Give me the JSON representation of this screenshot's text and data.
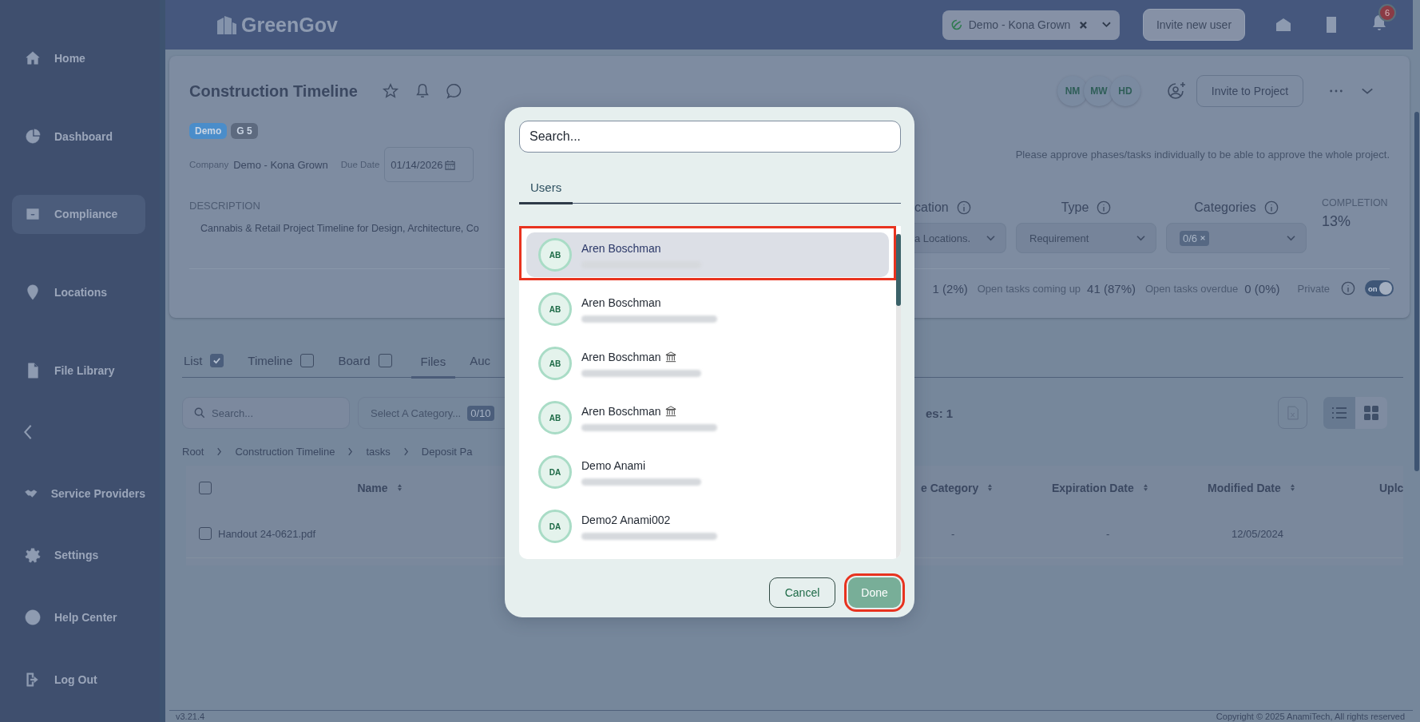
{
  "sidebar": {
    "items": [
      {
        "label": "Home",
        "selected": false
      },
      {
        "label": "Dashboard",
        "selected": false
      },
      {
        "label": "Compliance",
        "selected": true
      },
      {
        "label": "Locations",
        "selected": false
      },
      {
        "label": "File Library",
        "selected": false
      }
    ],
    "lower_items": [
      {
        "label": "Service Providers",
        "selected": false
      },
      {
        "label": "Settings",
        "selected": false
      },
      {
        "label": "Help Center",
        "selected": false
      },
      {
        "label": "Log Out",
        "selected": false
      }
    ]
  },
  "topbar": {
    "logo": "GreenGov",
    "company_select": "Demo - Kona Grown",
    "invite_button": "Invite new user",
    "notification_count": "6"
  },
  "project": {
    "title": "Construction Timeline",
    "tags": [
      {
        "label": "Demo",
        "color": "#4a8dca"
      },
      {
        "label": "G 5",
        "color": "#5d6a7f"
      }
    ],
    "company_label": "Company",
    "company": "Demo - Kona Grown",
    "due_date_label": "Due Date",
    "due_date": "01/14/2026",
    "description_label": "DESCRIPTION",
    "description": "Cannabis & Retail Project Timeline for Design, Architecture, Co",
    "members": [
      "NM",
      "MW",
      "HD"
    ],
    "invite_button": "Invite to Project",
    "note": "Please approve phases/tasks individually to be able to approve the whole project.",
    "filters": [
      {
        "label": "cation",
        "kind": "select",
        "value": "a Locations."
      },
      {
        "label": "Type",
        "kind": "select",
        "value": "Requirement"
      },
      {
        "label": "Categories",
        "kind": "chip",
        "value": "0/6"
      }
    ],
    "completion_label": "COMPLETION",
    "completion": "13%",
    "stats": [
      {
        "value": "1 (2%)"
      },
      {
        "label": "Open tasks coming up",
        "value": "41 (87%)"
      },
      {
        "label": "Open tasks overdue",
        "value": "0 (0%)"
      }
    ],
    "private": {
      "label": "Private",
      "on": true,
      "toggle_text": "on"
    }
  },
  "view_tabs": [
    {
      "label": "List",
      "kind": "checkbox",
      "checked": true,
      "selected": false
    },
    {
      "label": "Timeline",
      "kind": "checkbox",
      "checked": false,
      "selected": false
    },
    {
      "label": "Board",
      "kind": "checkbox",
      "checked": false,
      "selected": false
    },
    {
      "label": "Files",
      "kind": "plain",
      "selected": true
    },
    {
      "label": "Auc",
      "kind": "plain",
      "selected": false
    }
  ],
  "files": {
    "search_placeholder": "Search...",
    "category_placeholder": "Select A Category...",
    "category_count": "0/10",
    "file_count": "es: 1",
    "view_toggle": [
      {
        "selected": true
      },
      {
        "selected": false
      }
    ],
    "breadcrumb": [
      "Root",
      "Construction Timeline",
      "tasks",
      "Deposit Pa"
    ],
    "select_all_checked": false,
    "columns": [
      {
        "label": "Name",
        "sortable": true
      },
      {
        "label": "e Category",
        "sortable": true
      },
      {
        "label": "Expiration Date",
        "sortable": true
      },
      {
        "label": "Modified Date",
        "sortable": true
      },
      {
        "label": "Uplc",
        "sortable": false
      }
    ],
    "rows": [
      {
        "checked": false,
        "cells": [
          "Handout 24-0621.pdf",
          "-",
          "-",
          "12/05/2024"
        ]
      }
    ]
  },
  "footer": {
    "version": "v3.21.4",
    "copyright": "Copyright © 2025 AnamiTech, All rights reserved"
  },
  "modal": {
    "search_placeholder": "Search...",
    "tabs": [
      {
        "label": "Users",
        "selected": true
      }
    ],
    "users": [
      {
        "initials": "AB",
        "name": "Aren Boschman",
        "institution": false,
        "selected": true,
        "highlighted": true
      },
      {
        "initials": "AB",
        "name": "Aren Boschman",
        "institution": false,
        "selected": false,
        "highlighted": false
      },
      {
        "initials": "AB",
        "name": "Aren Boschman",
        "institution": true,
        "selected": false,
        "highlighted": false
      },
      {
        "initials": "AB",
        "name": "Aren Boschman",
        "institution": true,
        "selected": false,
        "highlighted": false
      },
      {
        "initials": "DA",
        "name": "Demo Anami",
        "institution": false,
        "selected": false,
        "highlighted": false
      },
      {
        "initials": "DA",
        "name": "Demo2 Anami002",
        "institution": false,
        "selected": false,
        "highlighted": false
      }
    ],
    "cancel_button": "Cancel",
    "done_button": {
      "label": "Done",
      "highlighted": true
    }
  }
}
